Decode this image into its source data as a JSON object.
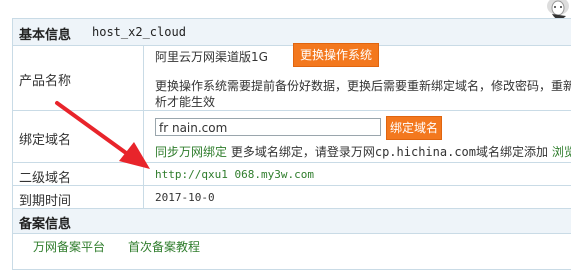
{
  "basic": {
    "section_title": "基本信息",
    "host": "host_x2_cloud"
  },
  "product": {
    "label": "产品名称",
    "value": "阿里云万网渠道版1G",
    "change_os_button": "更换操作系统",
    "warning_line1": "更换操作系统需要提前备份好数据，更换后需要重新绑定域名，修改密码，重新",
    "warning_line2": "析才能生效"
  },
  "bind": {
    "label": "绑定域名",
    "input_value": "fr    nain.com",
    "bind_button": "绑定域名",
    "sync_link": "同步万网绑定",
    "more_text": "更多域名绑定，请登录万网",
    "site": "cp.hichina.com",
    "more_text2": "域名绑定添加",
    "browse_link": "浏览"
  },
  "subdomain": {
    "label": "二级域名",
    "url": "http://qxu1        068.my3w.com"
  },
  "expiry": {
    "label": "到期时间",
    "value": "2017-10-0"
  },
  "record": {
    "section_title": "备案信息",
    "platform_link": "万网备案平台",
    "tutorial_link": "首次备案教程"
  },
  "colors": {
    "accent": "#f3781e",
    "link": "#2f7d2c",
    "arrow": "#e8242b",
    "border": "#c9dbe6"
  }
}
